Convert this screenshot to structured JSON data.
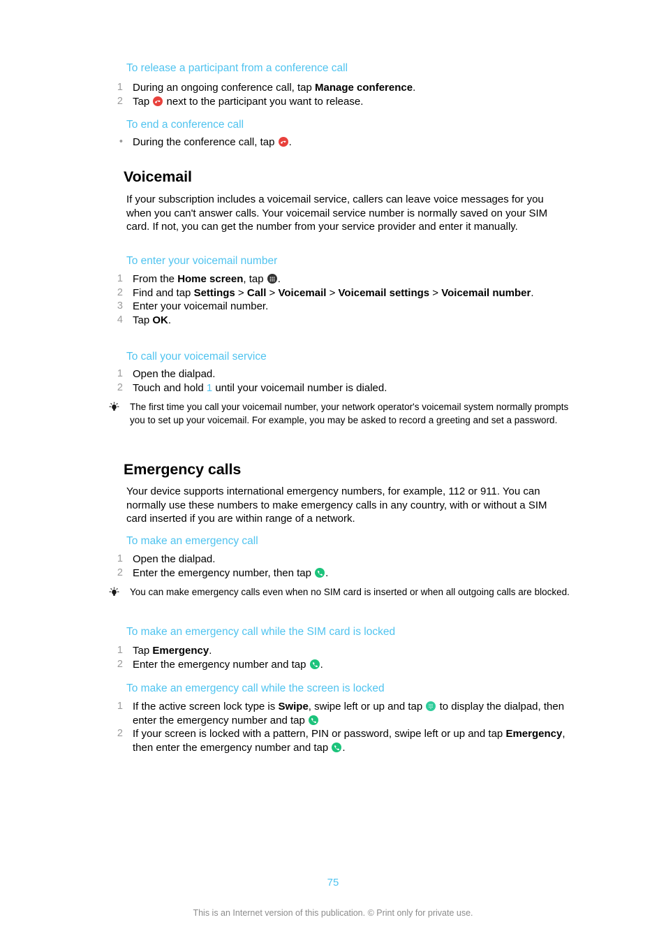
{
  "document": {
    "page_number": "75",
    "footer_note": "This is an Internet version of this publication. © Print only for private use."
  },
  "colors": {
    "heading_cyan": "#4fc3ef",
    "end_call_red": "#e8413c",
    "call_green": "#1cc37b",
    "dialpad_teal": "#2ecc9b",
    "apps_dark": "#333333",
    "list_number_gray": "#9b9b9b",
    "footer_gray": "#8c8c8c"
  },
  "sections": {
    "release_participant": {
      "heading": "To release a participant from a conference call",
      "steps": [
        {
          "num": "1",
          "pre": "During an ongoing conference call, tap ",
          "bold": "Manage conference",
          "post": ".",
          "icon": null
        },
        {
          "num": "2",
          "pre": "Tap ",
          "icon": "end-call-icon",
          "post": " next to the participant you want to release."
        }
      ]
    },
    "end_conference": {
      "heading": "To end a conference call",
      "steps": [
        {
          "bullet": "•",
          "pre": "During the conference call, tap ",
          "icon": "end-call-icon",
          "post": "."
        }
      ]
    },
    "voicemail": {
      "heading": "Voicemail",
      "body": "If your subscription includes a voicemail service, callers can leave voice messages for you when you can't answer calls. Your voicemail service number is normally saved on your SIM card. If not, you can get the number from your service provider and enter it manually.",
      "enter_number": {
        "heading": "To enter your voicemail number",
        "steps": [
          {
            "num": "1",
            "pre": "From the ",
            "bold": "Home screen",
            "mid": ", tap ",
            "icon": "apps-grid-icon",
            "post": "."
          },
          {
            "num": "2",
            "pre": "Find and tap ",
            "path": [
              "Settings",
              "Call",
              "Voicemail",
              "Voicemail settings",
              "Voicemail number"
            ],
            "separator": " > ",
            "post": "."
          },
          {
            "num": "3",
            "pre": "Enter your voicemail number."
          },
          {
            "num": "4",
            "pre": "Tap ",
            "bold": "OK",
            "post": "."
          }
        ]
      },
      "call_service": {
        "heading": "To call your voicemail service",
        "steps": [
          {
            "num": "1",
            "pre": "Open the dialpad."
          },
          {
            "num": "2",
            "pre": "Touch and hold ",
            "cyan": "1",
            "post": " until your voicemail number is dialed."
          }
        ],
        "tip": "The first time you call your voicemail number, your network operator's voicemail system normally prompts you to set up your voicemail. For example, you may be asked to record a greeting and set a password."
      }
    },
    "emergency_calls": {
      "heading": "Emergency calls",
      "body": "Your device supports international emergency numbers, for example, 112 or 911. You can normally use these numbers to make emergency calls in any country, with or without a SIM card inserted if you are within range of a network.",
      "make_call": {
        "heading": "To make an emergency call",
        "steps": [
          {
            "num": "1",
            "pre": "Open the dialpad."
          },
          {
            "num": "2",
            "pre": "Enter the emergency number, then tap ",
            "icon": "call-icon",
            "post": "."
          }
        ],
        "tip": "You can make emergency calls even when no SIM card is inserted or when all outgoing calls are blocked."
      },
      "sim_locked": {
        "heading": "To make an emergency call while the SIM card is locked",
        "steps": [
          {
            "num": "1",
            "pre": "Tap ",
            "bold": "Emergency",
            "post": "."
          },
          {
            "num": "2",
            "pre": "Enter the emergency number and tap ",
            "icon": "call-icon",
            "post": "."
          }
        ]
      },
      "screen_locked": {
        "heading": "To make an emergency call while the screen is locked",
        "steps": [
          {
            "num": "1",
            "pre": "If the active screen lock type is ",
            "bold": "Swipe",
            "mid": ", swipe left or up and tap ",
            "icon": "dialpad-icon",
            "mid2": " to display the dialpad, then enter the emergency number and tap ",
            "icon2": "call-icon",
            "post": ""
          },
          {
            "num": "2",
            "pre": "If your screen is locked with a pattern, PIN or password, swipe left or up and tap ",
            "bold": "Emergency",
            "mid": ", then enter the emergency number and tap ",
            "icon": "call-icon",
            "post": "."
          }
        ]
      }
    }
  }
}
